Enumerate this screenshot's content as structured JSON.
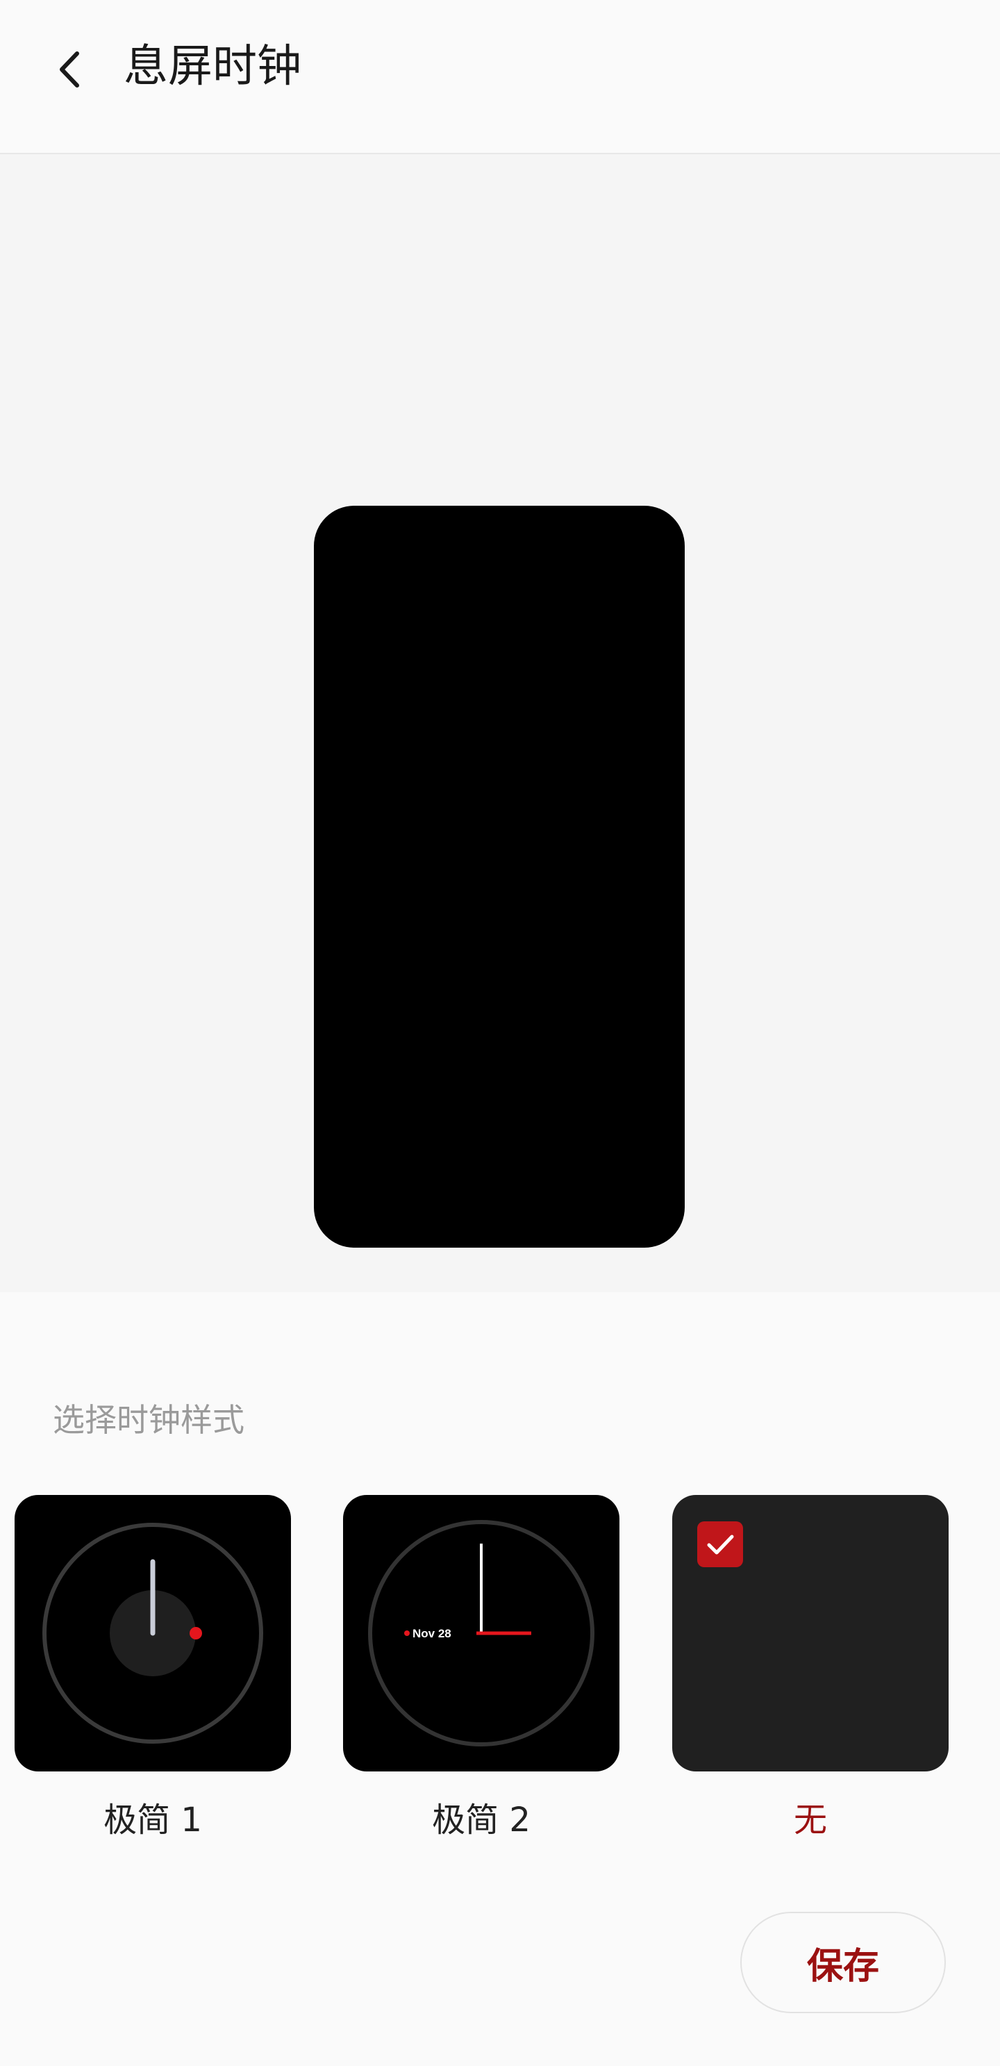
{
  "header": {
    "title": "息屏时钟",
    "back_icon": "chevron-left-icon"
  },
  "preview": {
    "background": "#000000"
  },
  "styles_section": {
    "label": "选择时钟样式",
    "options": [
      {
        "label": "极简 1",
        "selected": false
      },
      {
        "label": "极简 2",
        "selected": false,
        "date_text": "Nov 28"
      },
      {
        "label": "无",
        "selected": true,
        "check_icon": "checkmark-icon"
      }
    ]
  },
  "actions": {
    "save_label": "保存"
  },
  "colors": {
    "accent": "#9b1111",
    "check_bg": "#c0161a",
    "clock_red": "#e5161d"
  }
}
